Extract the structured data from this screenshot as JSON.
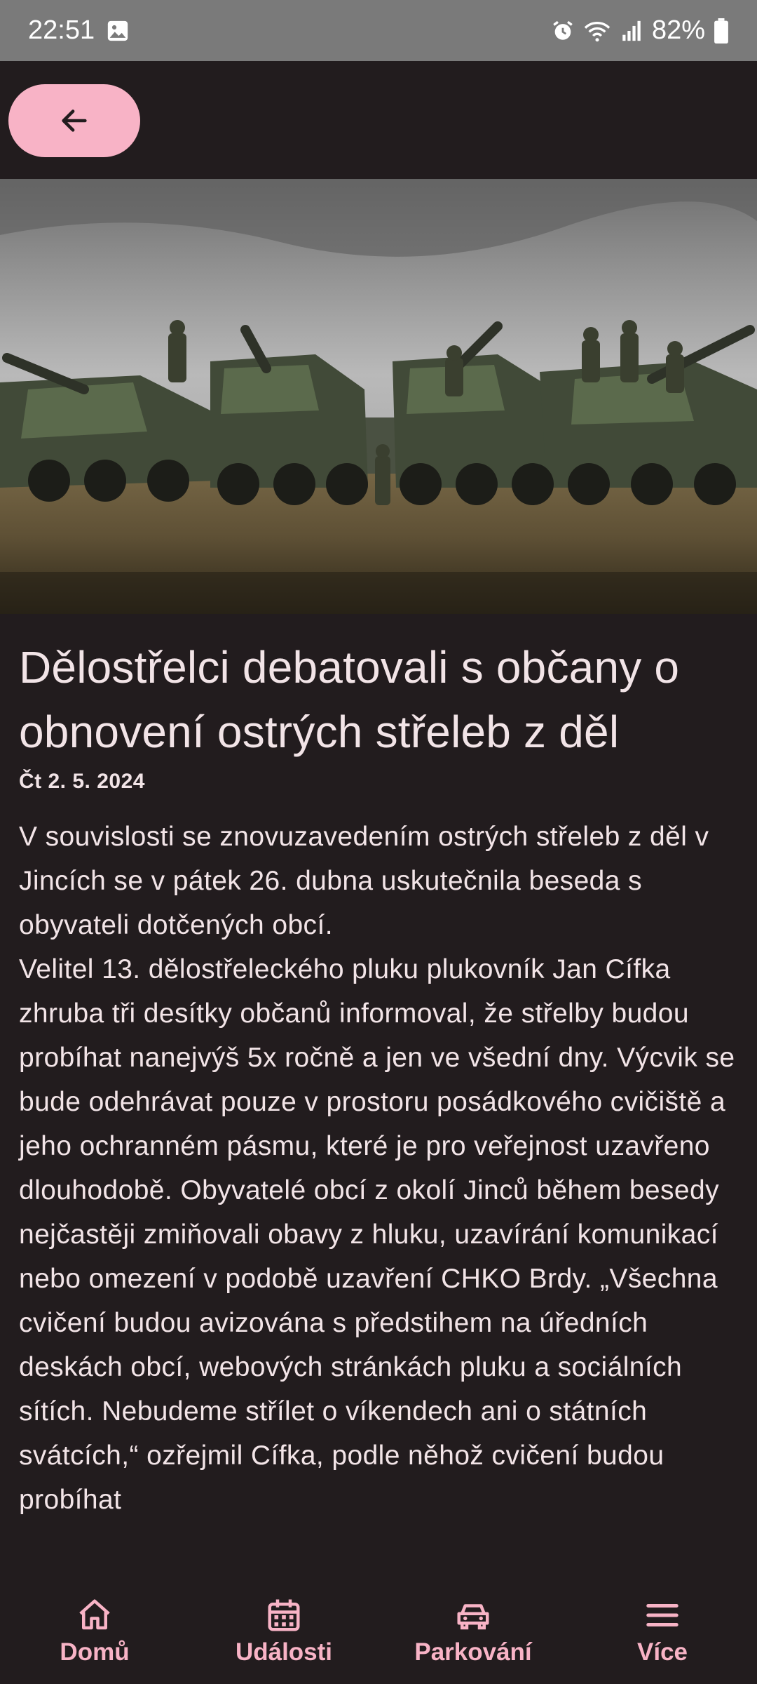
{
  "status_bar": {
    "time": "22:51",
    "battery": "82%",
    "icons": [
      "gallery-icon",
      "alarm-icon",
      "wifi-icon",
      "signal-icon",
      "battery-icon"
    ]
  },
  "top_bar": {
    "back_icon": "arrow-left-icon",
    "accent_color": "#f8b3c6"
  },
  "article": {
    "title": "Dělostřelci debatovali s občany o obnovení ostrých střeleb z děl",
    "date": "Čt 2. 5. 2024",
    "body": "V souvislosti se znovuzavedením ostrých střeleb z děl v Jincích se v pátek 26. dubna uskutečnila beseda s obyvateli dotčených obcí.\nVelitel 13. dělostřeleckého pluku plukovník Jan Cífka zhruba tři desítky občanů informoval, že střelby budou probíhat nanejvýš 5x ročně a jen ve všední dny. Výcvik se bude odehrávat pouze v prostoru posádkového cvičiště a jeho ochranném pásmu, které je pro veřejnost uzavřeno dlouhodobě. Obyvatelé obcí z okolí Jinců během besedy nejčastěji zmiňovali obavy z hluku, uzavírání komunikací nebo omezení v podobě uzavření CHKO Brdy. „Všechna cvičení budou avizována s předstihem na úředních deskách obcí, webových stránkách pluku a sociálních sítích. Nebudeme střílet o víkendech ani o státních svátcích,“ ozřejmil Cífka, podle něhož cvičení budou probíhat"
  },
  "bottom_nav": {
    "items": [
      {
        "label": "Domů",
        "icon": "home-icon"
      },
      {
        "label": "Události",
        "icon": "calendar-icon"
      },
      {
        "label": "Parkování",
        "icon": "car-icon"
      },
      {
        "label": "Více",
        "icon": "menu-icon"
      }
    ]
  }
}
